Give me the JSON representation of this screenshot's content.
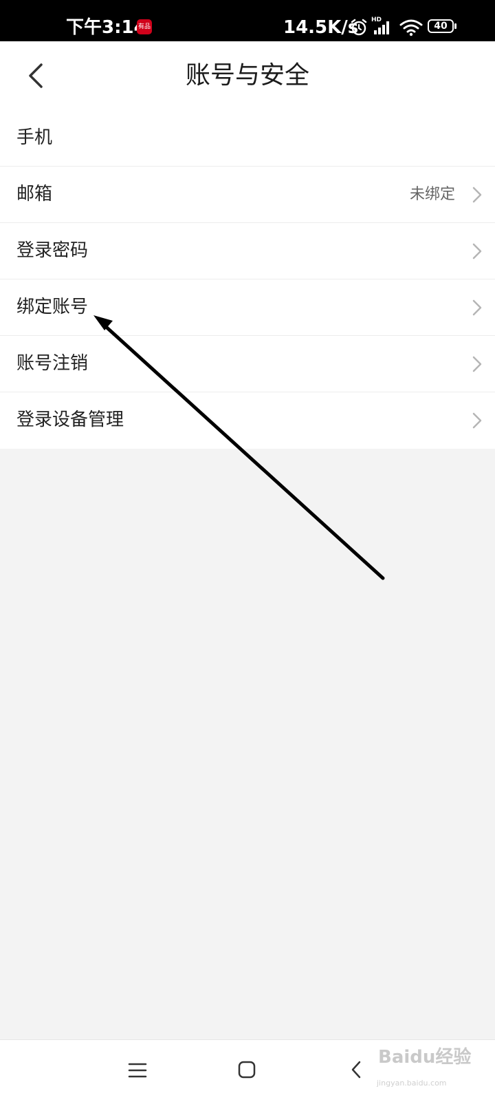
{
  "status_bar": {
    "time": "下午3:14",
    "app_badge": "有品",
    "net_speed": "14.5K/s",
    "network_label": "HD",
    "battery_level": "40"
  },
  "header": {
    "title": "账号与安全"
  },
  "settings": {
    "items": [
      {
        "label": "手机",
        "value": ""
      },
      {
        "label": "邮箱",
        "value": "未绑定"
      },
      {
        "label": "登录密码",
        "value": ""
      },
      {
        "label": "绑定账号",
        "value": ""
      },
      {
        "label": "账号注销",
        "value": ""
      },
      {
        "label": "登录设备管理",
        "value": ""
      }
    ]
  },
  "watermark": {
    "logo": "Baidu经验",
    "url": "jingyan.baidu.com"
  },
  "icons": {
    "back": "chevron-left-icon",
    "row_arrow": "chevron-right-icon",
    "nav_menu": "menu-icon",
    "nav_home": "home-icon",
    "nav_back": "back-icon"
  },
  "colors": {
    "status_bar_bg": "#000000",
    "page_bg": "#f3f3f3",
    "badge_red": "#d0021b",
    "chevron_gray": "#b5b5b5"
  }
}
